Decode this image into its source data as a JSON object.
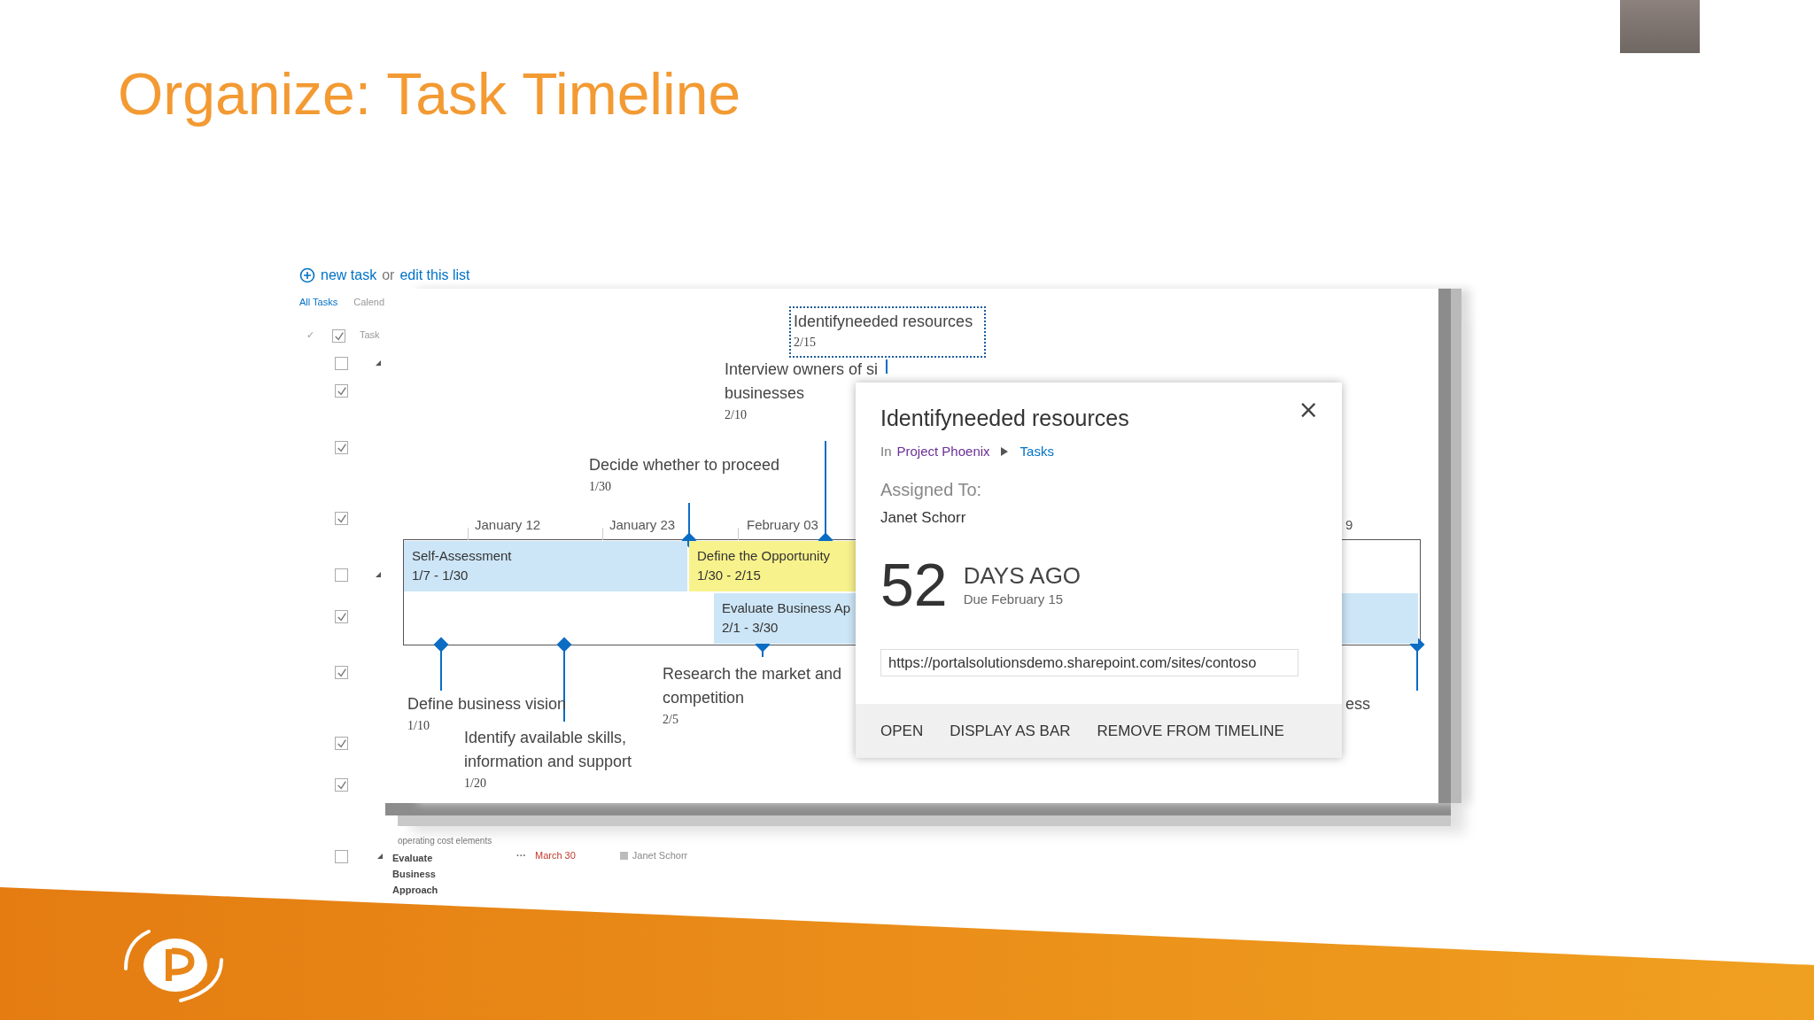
{
  "slide": {
    "title": "Organize: Task Timeline"
  },
  "task_list": {
    "new_task_link": "new task",
    "joiner": "or",
    "edit_link": "edit this list",
    "views": [
      "All Tasks",
      "Calend"
    ],
    "header": {
      "mark": "✓",
      "checked": true,
      "column": "Task"
    },
    "rows": [
      {
        "checked": false,
        "expand": true
      },
      {
        "checked": true,
        "expand": false
      },
      {
        "checked": true,
        "expand": false
      },
      {
        "checked": true,
        "expand": false
      },
      {
        "checked": false,
        "expand": true
      },
      {
        "checked": true,
        "expand": false
      },
      {
        "checked": true,
        "expand": false
      },
      {
        "checked": true,
        "expand": false
      },
      {
        "checked": true,
        "expand": false
      }
    ],
    "faded_text": "operating cost elements",
    "last_row": {
      "checked": false,
      "title": "Evaluate Business Approach",
      "menu": "···",
      "due": "March 30",
      "assignee": "Janet Schorr"
    }
  },
  "timeline": {
    "selected_milestone": {
      "title": "Identifyneeded resources",
      "date": "2/15"
    },
    "milestones": [
      {
        "lines": [
          "Interview owners of si",
          "businesses"
        ],
        "date": "2/10"
      },
      {
        "lines": [
          "Decide whether to proceed"
        ],
        "date": "1/30"
      },
      {
        "lines": [
          "Define business vision"
        ],
        "date": "1/10"
      },
      {
        "lines": [
          "Identify available skills,",
          "information and support"
        ],
        "date": "1/20"
      },
      {
        "lines": [
          "Research the market and",
          "competition"
        ],
        "date": "2/5"
      },
      {
        "lines": [
          "ess"
        ]
      }
    ],
    "axis_labels": [
      "January 12",
      "January 23",
      "February 03",
      "9"
    ],
    "bars": [
      {
        "title": "Self-Assessment",
        "dates": "1/7 - 1/30",
        "color": "#cde6f7"
      },
      {
        "title": "Define the Opportunity",
        "dates": "1/30 - 2/15",
        "color": "#f8f28c"
      },
      {
        "title": "Evaluate Business Ap",
        "dates": "2/1 - 3/30",
        "color": "#cde6f7"
      }
    ]
  },
  "callout": {
    "title": "Identifyneeded resources",
    "prefix": "In",
    "site": "Project Phoenix",
    "list": "Tasks",
    "assigned_label": "Assigned To:",
    "assignee": "Janet Schorr",
    "count": "52",
    "count_unit": "DAYS AGO",
    "due": "Due February 15",
    "url": "https://portalsolutionsdemo.sharepoint.com/sites/contoso",
    "close": "×",
    "actions": [
      "OPEN",
      "DISPLAY AS BAR",
      "REMOVE FROM TIMELINE"
    ]
  }
}
